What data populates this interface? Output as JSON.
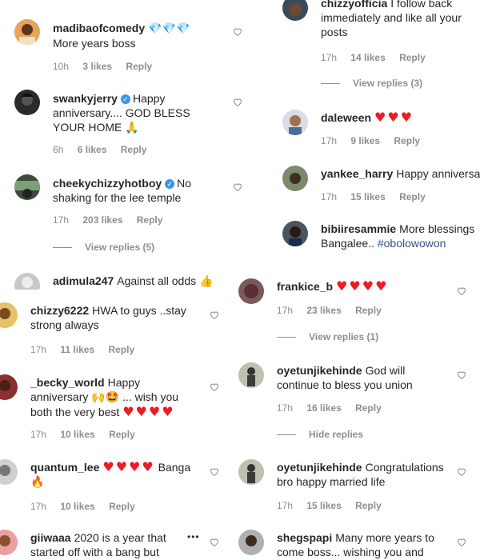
{
  "left_panel": {
    "c1": {
      "user": "madibaofcomedy",
      "emoji": "💎💎💎",
      "text": "More years boss",
      "time": "10h",
      "likes": "3 likes",
      "reply": "Reply"
    },
    "c2": {
      "user": "swankyjerry",
      "text": "Happy anniversary.... GOD BLESS YOUR HOME",
      "emoji": "🙏",
      "time": "6h",
      "likes": "6 likes",
      "reply": "Reply"
    },
    "c3": {
      "user": "cheekychizzyhotboy",
      "text": "No shaking for the lee temple",
      "time": "17h",
      "likes": "203 likes",
      "reply": "Reply",
      "view_replies": "View replies (5)"
    },
    "c4": {
      "user": "adimula247",
      "text": "Against all odds",
      "emoji": "👍"
    }
  },
  "right_top_panel": {
    "c1": {
      "user": "chizzyofficia",
      "text": "I follow back immediately and like all your posts",
      "time": "17h",
      "likes": "14 likes",
      "reply": "Reply",
      "view_replies": "View replies (3)"
    },
    "c2": {
      "user": "daleween",
      "hearts": "♥♥♥",
      "time": "17h",
      "likes": "9 likes",
      "reply": "Reply"
    },
    "c3": {
      "user": "yankee_harry",
      "text": "Happy anniversary",
      "time": "17h",
      "likes": "15 likes",
      "reply": "Reply"
    },
    "c4": {
      "user": "bibiiresammie",
      "text": "More blessings Bangalee..",
      "hashtag": "#obolowowon"
    }
  },
  "bottom_left_panel": {
    "c1": {
      "user": "chizzy6222",
      "text": "HWA to guys ..stay strong always",
      "time": "17h",
      "likes": "11 likes",
      "reply": "Reply"
    },
    "c2": {
      "user": "_becky_world",
      "text": "Happy anniversary",
      "emoji": "🙌🤩",
      "text2": "... wish you both the very best",
      "hearts": "♥♥♥♥",
      "time": "17h",
      "likes": "10 likes",
      "reply": "Reply"
    },
    "c3": {
      "user": "quantum_lee",
      "hearts": "♥♥♥♥",
      "text": "Banga",
      "emoji": "🔥",
      "time": "17h",
      "likes": "10 likes",
      "reply": "Reply"
    },
    "c4": {
      "user": "giiwaaa",
      "text": "2020 is a year that started off with a bang but",
      "more": "•••"
    }
  },
  "bottom_right_panel": {
    "c1": {
      "user": "frankice_b",
      "hearts": "♥♥♥♥",
      "time": "17h",
      "likes": "23 likes",
      "reply": "Reply",
      "view_replies": "View replies (1)"
    },
    "c2": {
      "user": "oyetunjikehinde",
      "text": "God will continue to bless you union",
      "time": "17h",
      "likes": "16 likes",
      "reply": "Reply",
      "hide_replies": "Hide replies"
    },
    "c3": {
      "user": "oyetunjikehinde",
      "text": "Congratulations bro happy married life",
      "time": "17h",
      "likes": "15 likes",
      "reply": "Reply"
    },
    "c4": {
      "user": "shegspapi",
      "text": "Many more years to come boss... wishing you and"
    }
  },
  "colors": {
    "heart": "#ed1c24",
    "verified": "#3897f0",
    "meta": "#8e8e8e",
    "hashtag": "#385185"
  },
  "icons": {
    "like": "heart-outline-icon",
    "verified": "verified-badge-icon",
    "more": "more-options-icon"
  }
}
